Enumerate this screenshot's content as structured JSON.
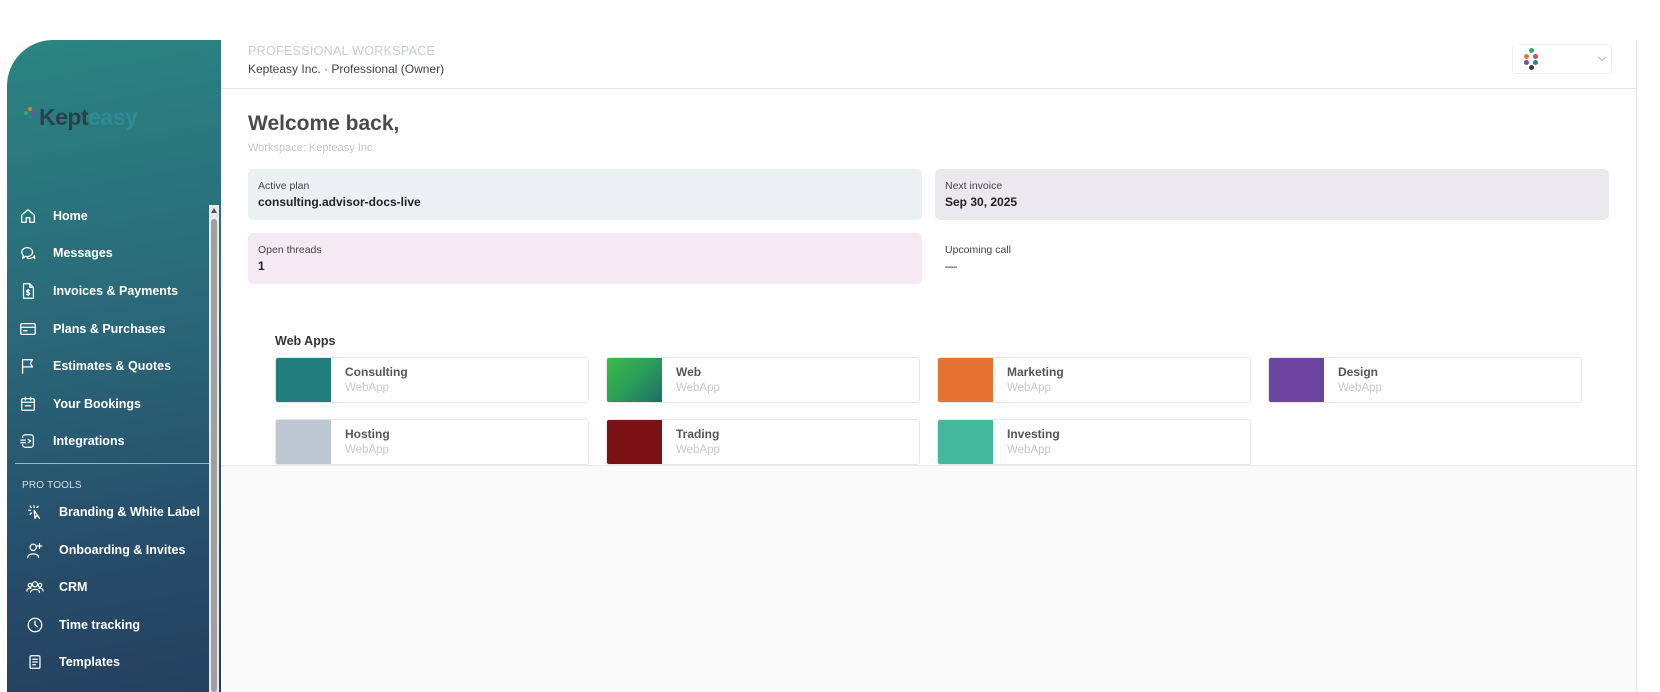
{
  "brand": {
    "kept": "Kept",
    "easy": "easy"
  },
  "nav": {
    "items": [
      {
        "label": "Home",
        "icon": "home-icon"
      },
      {
        "label": "Messages",
        "icon": "chat-icon"
      },
      {
        "label": "Invoices & Payments",
        "icon": "invoice-icon"
      },
      {
        "label": "Plans & Purchases",
        "icon": "card-icon"
      },
      {
        "label": "Estimates & Quotes",
        "icon": "flag-icon"
      },
      {
        "label": "Your Bookings",
        "icon": "calendar-icon"
      },
      {
        "label": "Integrations",
        "icon": "plug-icon"
      }
    ],
    "pro_label": "PRO TOOLS",
    "pro_items": [
      {
        "label": "Branding & White Label",
        "icon": "sparkle-cursor-icon"
      },
      {
        "label": "Onboarding & Invites",
        "icon": "user-plus-icon"
      },
      {
        "label": "CRM",
        "icon": "users-icon"
      },
      {
        "label": "Time tracking",
        "icon": "clock-icon"
      },
      {
        "label": "Templates",
        "icon": "document-icon"
      }
    ]
  },
  "header": {
    "workspace_label": "PROFESSIONAL WORKSPACE",
    "workspace_sub": "Kepteasy Inc. · Professional (Owner)"
  },
  "main": {
    "welcome": "Welcome back,",
    "workspace_line": "Workspace: Kepteasy Inc.",
    "cards": [
      {
        "label": "Active plan",
        "value": "consulting.advisor-docs-live"
      },
      {
        "label": "Next invoice",
        "value": "Sep 30, 2025"
      },
      {
        "label": "Open threads",
        "value": "1"
      },
      {
        "label": "Upcoming call",
        "value": "—"
      }
    ],
    "apps_title": "Web Apps",
    "apps": [
      {
        "name": "Consulting",
        "type": "WebApp",
        "color": "#227d7d"
      },
      {
        "name": "Web",
        "type": "WebApp",
        "color": "#2aa84a"
      },
      {
        "name": "Marketing",
        "type": "WebApp",
        "color": "#e57432"
      },
      {
        "name": "Design",
        "type": "WebApp",
        "color": "#6d44a0"
      },
      {
        "name": "Hosting",
        "type": "WebApp",
        "color": "#bec8d2"
      },
      {
        "name": "Trading",
        "type": "WebApp",
        "color": "#7a1216"
      },
      {
        "name": "Investing",
        "type": "WebApp",
        "color": "#43b89b"
      }
    ]
  },
  "colors": {
    "card_plan": "#ebf1f3",
    "card_invoice": "#ebe9ee",
    "card_threads": "#f5eaf3",
    "card_call": "#ffffff"
  }
}
